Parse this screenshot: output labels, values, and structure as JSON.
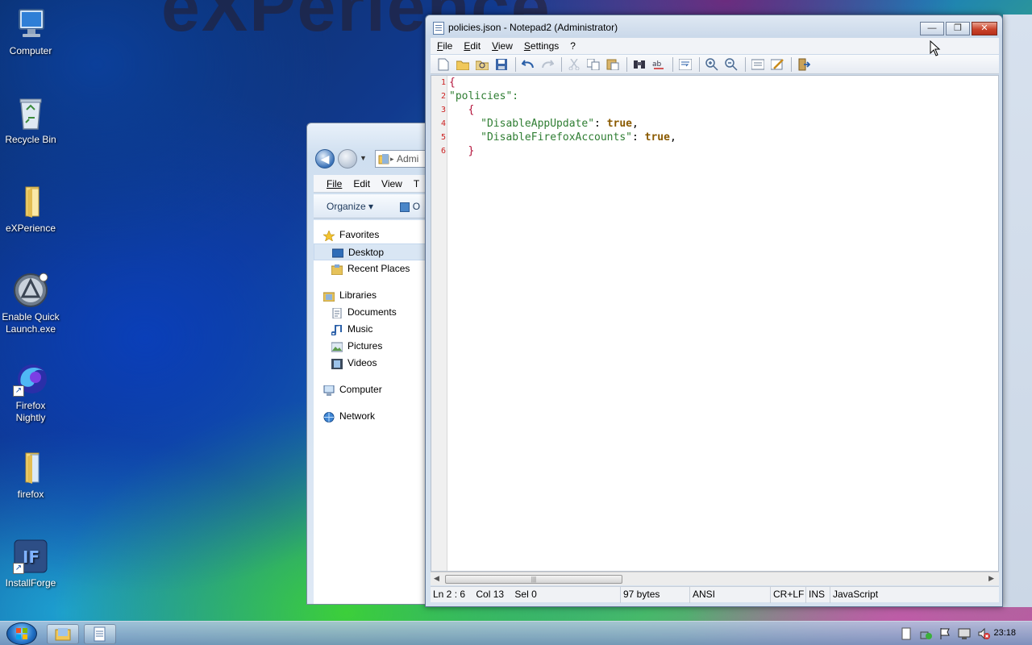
{
  "desktop": {
    "watermark": "eXPerience",
    "icons": [
      {
        "label": "Computer"
      },
      {
        "label": "Recycle Bin"
      },
      {
        "label": "eXPerience"
      },
      {
        "label": "Enable Quick Launch.exe"
      },
      {
        "label": "Firefox Nightly"
      },
      {
        "label": "firefox"
      },
      {
        "label": "InstallForge"
      }
    ]
  },
  "explorer": {
    "address_text": "Admi",
    "menu": [
      "File",
      "Edit",
      "View",
      "T"
    ],
    "toolbar": {
      "organize": "Organize",
      "next": "O"
    },
    "nav": [
      {
        "label": "Favorites",
        "icon": "star-icon",
        "group": true
      },
      {
        "label": "Desktop",
        "icon": "desktop-icon",
        "selected": true
      },
      {
        "label": "Recent Places",
        "icon": "recent-places-icon"
      },
      {
        "label": "Libraries",
        "icon": "libraries-icon",
        "group": true
      },
      {
        "label": "Documents",
        "icon": "documents-icon"
      },
      {
        "label": "Music",
        "icon": "music-icon"
      },
      {
        "label": "Pictures",
        "icon": "pictures-icon"
      },
      {
        "label": "Videos",
        "icon": "videos-icon"
      },
      {
        "label": "Computer",
        "icon": "computer-icon",
        "group": true
      },
      {
        "label": "Network",
        "icon": "network-icon",
        "group": true
      }
    ]
  },
  "notepad": {
    "title": "policies.json - Notepad2 (Administrator)",
    "caption_buttons": {
      "minimize": "—",
      "restore": "❐",
      "close": "✕"
    },
    "menu": [
      "File",
      "Edit",
      "View",
      "Settings",
      "?"
    ],
    "lines": [
      {
        "num": "1",
        "text": "{"
      },
      {
        "num": "2",
        "text": "\"policies\":"
      },
      {
        "num": "3",
        "text": "   {"
      },
      {
        "num": "4",
        "key": "\"DisableAppUpdate\"",
        "sep": ": ",
        "value": "true",
        "tail": ","
      },
      {
        "num": "5",
        "key": "\"DisableFirefoxAccounts\"",
        "sep": ": ",
        "value": "true",
        "tail": ","
      },
      {
        "num": "6",
        "text": "   }"
      }
    ],
    "status": {
      "position": "Ln 2 : 6",
      "column": "Col 13",
      "selection": "Sel 0",
      "size": "97 bytes",
      "encoding": "ANSI",
      "line_endings": "CR+LF",
      "mode": "INS",
      "language": "JavaScript"
    }
  },
  "taskbar": {
    "clock": "23:18"
  },
  "colors": {
    "json_key": "#2e7d32",
    "json_bool": "#8a5a00",
    "json_brace": "#b3123a",
    "line_number": "#cc2222"
  }
}
